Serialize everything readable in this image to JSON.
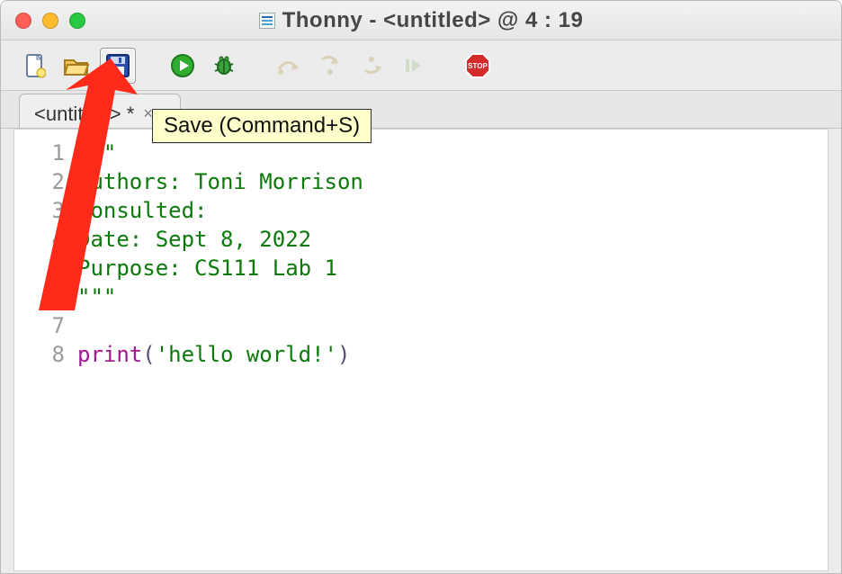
{
  "window": {
    "title": "Thonny  -  <untitled>  @  4 : 19"
  },
  "toolbar": {
    "tooltip_save": "Save (Command+S)"
  },
  "tabs": {
    "active": {
      "label": "<untitled> *"
    }
  },
  "gutter": [
    "1",
    "2",
    "3",
    "4",
    "5",
    "6",
    "7",
    "8"
  ],
  "code": {
    "l1": "\"\"\"",
    "l2": "Authors: Toni Morrison",
    "l3": "Consulted:",
    "l4": "Date: Sept 8, 2022",
    "l5": "Purpose: CS111 Lab 1",
    "l6": "\"\"\"",
    "l7": "",
    "l8_print": "print",
    "l8_open": "(",
    "l8_str": "'hello world!'",
    "l8_close": ")"
  }
}
